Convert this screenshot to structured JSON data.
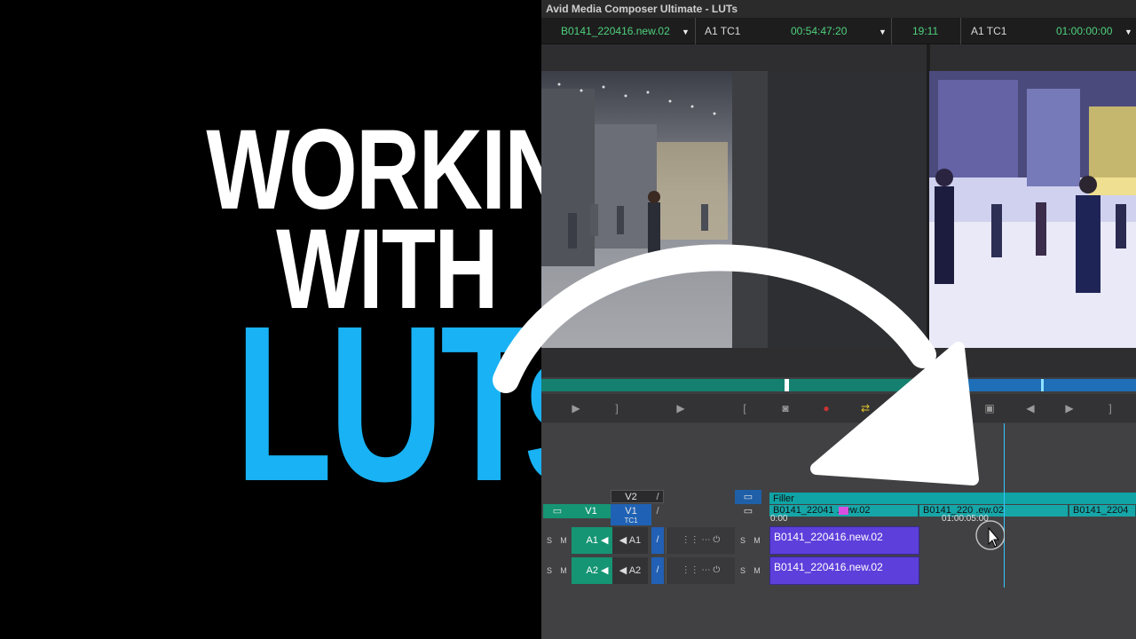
{
  "thumbnail": {
    "title_lines": [
      "WORKING",
      "WITH",
      "LUTs"
    ],
    "accent_color": "#19b2f4"
  },
  "app": {
    "window_title": "Avid Media Composer Ultimate - LUTs",
    "source": {
      "clip_name": "B0141_220416.new.02",
      "track_label": "A1  TC1",
      "timecode": "00:54:47:20"
    },
    "record": {
      "duration": "19:11",
      "track_label": "A1  TC1",
      "timecode": "01:00:00:00"
    },
    "timeline": {
      "tracks": {
        "v2": "V2",
        "v1_source": "V1",
        "v1": "V1",
        "tc1": "TC1",
        "a1_source": "A1",
        "a1": "A1",
        "a2_source": "A2",
        "a2": "A2"
      },
      "solo_label": "S",
      "mute_label": "M",
      "filler_label": "Filler",
      "timecode_ruler": [
        "0:00",
        "01:00:05:00"
      ],
      "v1_clips": [
        "B0141_22041",
        ".new.02",
        "B0141_220",
        ".ew.02",
        "B0141_2204"
      ],
      "a1_clip": "B0141_220416.new.02",
      "a2_clip": "B0141_220416.new.02"
    }
  }
}
